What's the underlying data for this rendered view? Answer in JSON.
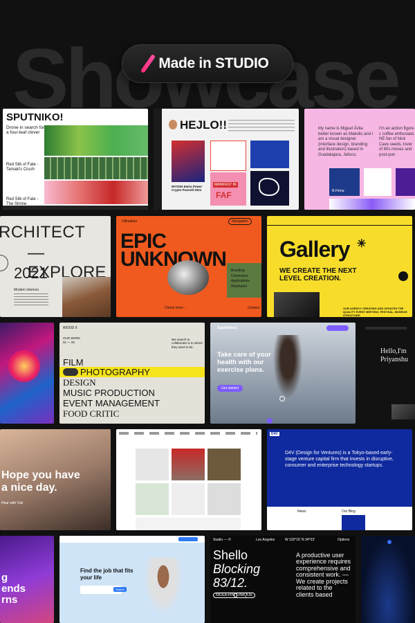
{
  "hero": {
    "bg_word": "Showcase",
    "badge": "Made in STUDIO",
    "accent": "#ff2d7a"
  },
  "sputniko": {
    "title": "SPUTNIKO!",
    "item1": "Drone in search for a four-leaf clover",
    "item2": "Red Silk of Fate - Tamaki's Crush",
    "item3": "Red Silk of Fate - The Shrine"
  },
  "hejlo": {
    "title": "HEJLO!!",
    "caption": "MYSON Ewns Power Crypto Punnell 2021",
    "tag1": "MANIFEST IN",
    "tag2": "FAF"
  },
  "pink": {
    "intro": "My name is Miguel Ávila better known as Makolis and I am a visual designer (interface design, branding and illustration) based in Guadalajara, Jalisco.",
    "side": "I'm an action figure c coffee enthusiast. NE fan of Nick Cave seeds, lover of 80s moves and post-pun",
    "tile": "B.Firma"
  },
  "architect": {
    "l1": "RCHITECT",
    "l2": "— EXPLORE",
    "year": "2021",
    "small": "Modern interiors"
  },
  "epic": {
    "top": "Ultimation",
    "nav": "Navigation",
    "h1": "EPIC",
    "h2": "UNKNOWN",
    "tags": [
      "Branding",
      "Commerce",
      "Applications",
      "Wireframe"
    ],
    "more": "Check more →",
    "contact": "Contact"
  },
  "gallery": {
    "title": "Gallery",
    "tagline": "WE CREATE THE NEXT LEVEL CREATION.",
    "foot": "OUR AGENCY CREATING AND UPDATES THE QUALITY EVENT MEETING, FESTIVAL, MUSEUM STRUCTURE"
  },
  "work": {
    "top": "WOOD X",
    "label": "OUR WORK",
    "range": "01 — 06",
    "search": "We search to collaborate w to where they want to be.",
    "items": [
      "FILM",
      "PHOTOGRAPHY",
      "DESIGN",
      "MUSIC PRODUCTION",
      "EVENT MANAGEMENT",
      "FOOD CRITIC"
    ]
  },
  "health": {
    "brand": "Supafitness",
    "headline": "Take care of your health with our exercise plans.",
    "btn": "Get started"
  },
  "hello": {
    "line1": "Hello,I'm",
    "line2": "Priyanshu"
  },
  "hope": {
    "line1": "Hope you have",
    "line2": "a nice day.",
    "small": "Hear with Toki"
  },
  "design": {
    "logo": "D4V",
    "text": "D4V (Design for Ventures) is a Tokyo-based early-stage venture capital firm that invests in disruptive, consumer and enterprise technology startups.",
    "news": "News",
    "blog": "Our Blog"
  },
  "job": {
    "headline": "Find the job that fits your life",
    "btn": "Search"
  },
  "shello": {
    "top": "Studio — ©",
    "city": "Los Angeles",
    "coords": "W 118°15' N 34°03'",
    "options": "Options",
    "h1": "Shello",
    "h2": "Blocking",
    "h3": "83/12.",
    "tag1": "MODERN",
    "tag2": "UNIQUE",
    "body": "A productive user experience requires comprehensive and consistent work. — We create projects related to the clients based"
  },
  "gradient": {
    "line1": "g",
    "line2": "ends",
    "line3": "rns"
  }
}
